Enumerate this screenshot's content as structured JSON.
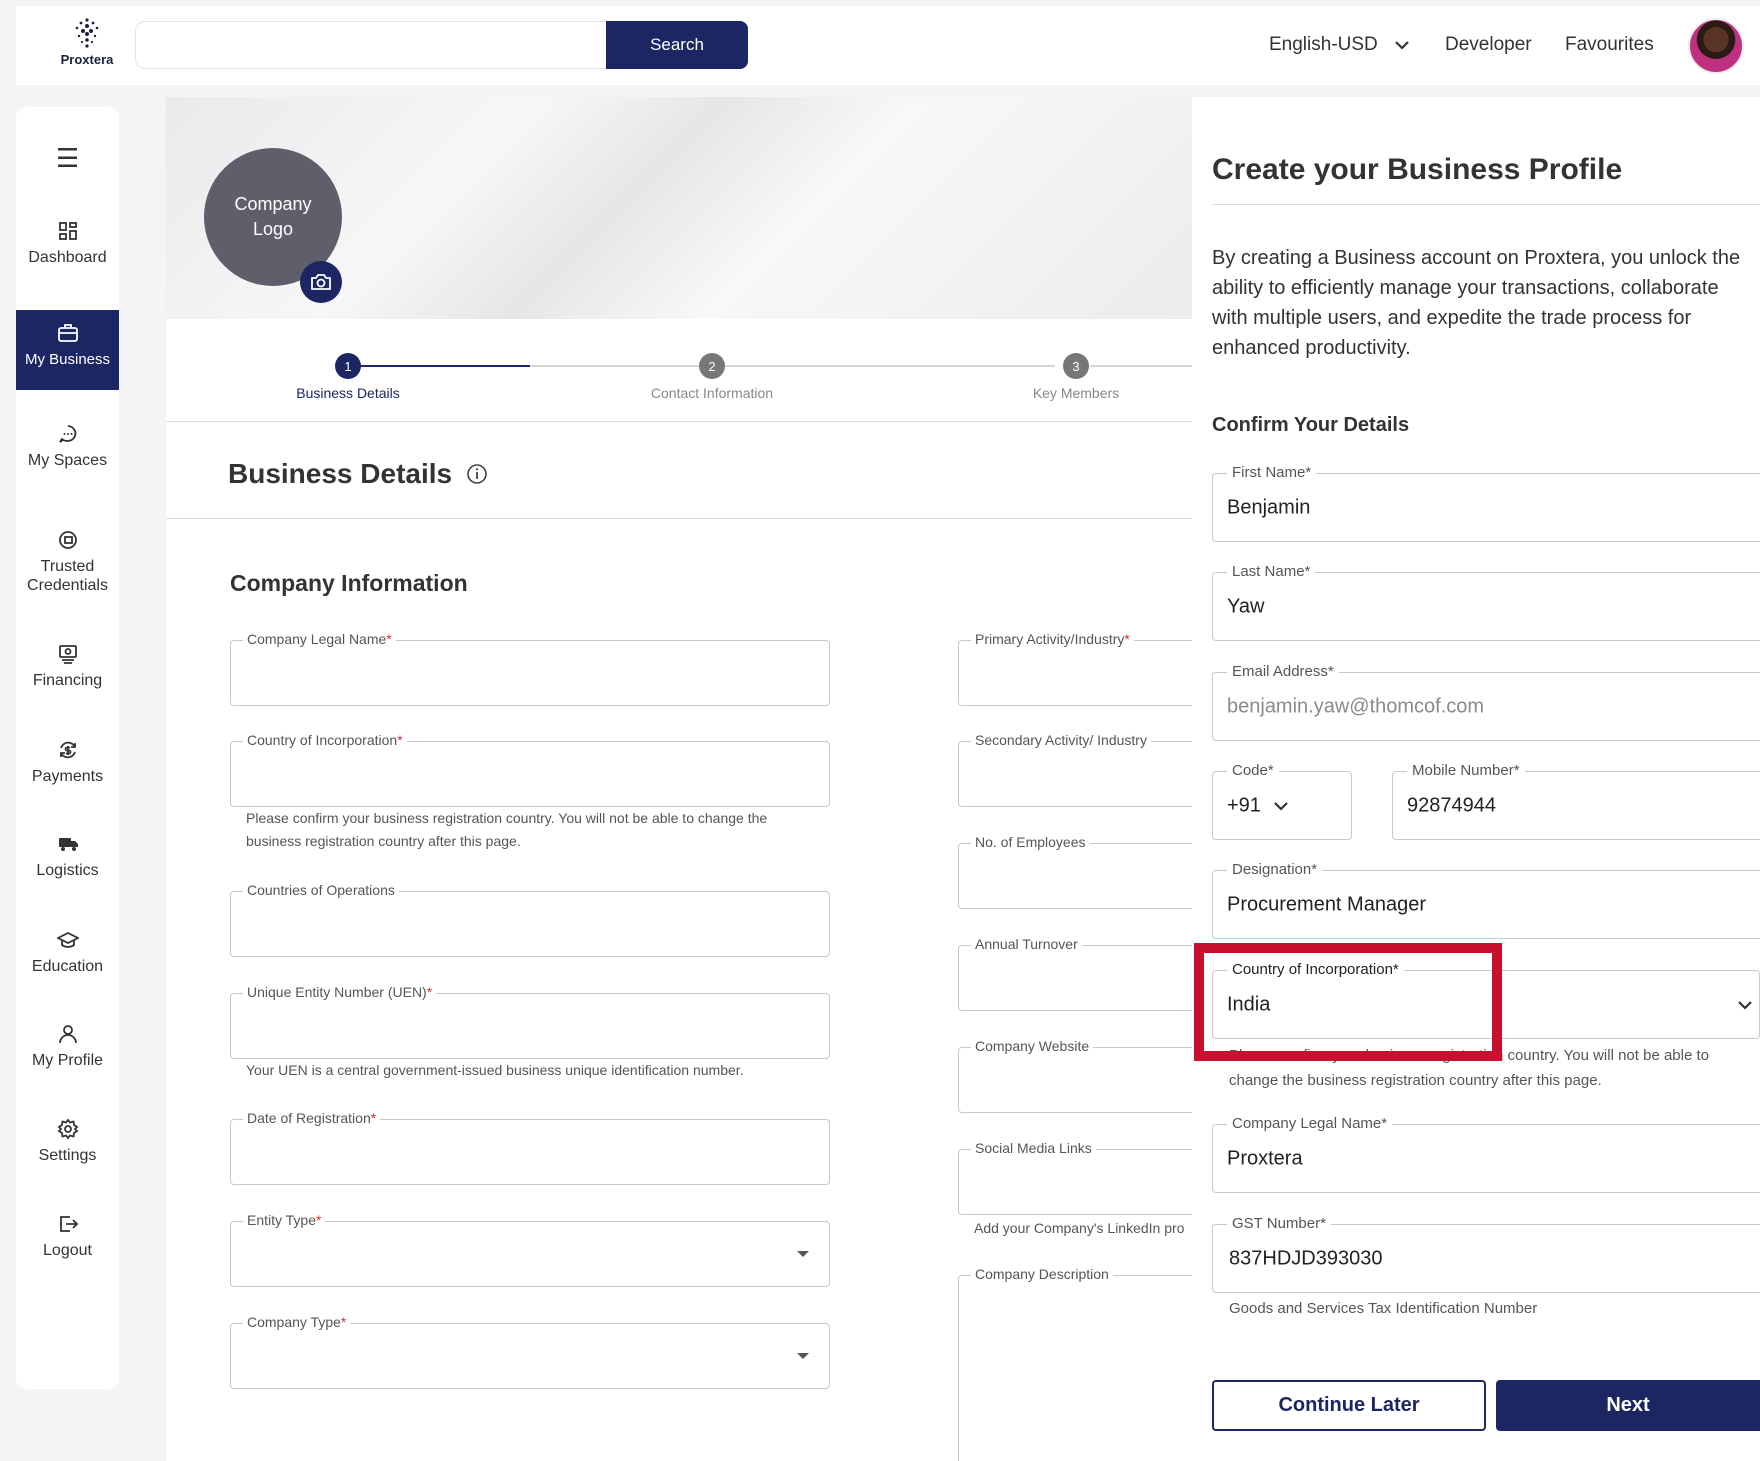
{
  "brand": {
    "name": "Proxtera"
  },
  "topbar": {
    "search_button": "Search",
    "language": "English-USD",
    "developer": "Developer",
    "favourites": "Favourites"
  },
  "sidebar": {
    "items": [
      {
        "label": "Dashboard",
        "icon": "dashboard-icon"
      },
      {
        "label": "My Business",
        "icon": "briefcase-icon",
        "active": true
      },
      {
        "label": "My Spaces",
        "icon": "chat-icon"
      },
      {
        "label": "Trusted Credentials",
        "icon": "credentials-icon"
      },
      {
        "label": "Financing",
        "icon": "financing-icon"
      },
      {
        "label": "Payments",
        "icon": "payments-icon"
      },
      {
        "label": "Logistics",
        "icon": "truck-icon"
      },
      {
        "label": "Education",
        "icon": "graduation-cap-icon"
      },
      {
        "label": "My Profile",
        "icon": "user-icon"
      },
      {
        "label": "Settings",
        "icon": "gear-icon"
      },
      {
        "label": "Logout",
        "icon": "logout-icon"
      }
    ]
  },
  "hero": {
    "logo_placeholder": "Company Logo"
  },
  "steps": [
    {
      "num": "1",
      "label": "Business Details",
      "active": true
    },
    {
      "num": "2",
      "label": "Contact Information"
    },
    {
      "num": "3",
      "label": "Key Members"
    }
  ],
  "business": {
    "title": "Business Details",
    "section": "Company Information",
    "left_fields": {
      "legal_name": "Company Legal Name",
      "country": "Country of Incorporation",
      "country_help": "Please confirm your business registration country. You will not be able to change the business registration country after this page.",
      "countries_ops": "Countries of Operations",
      "uen": "Unique Entity Number (UEN)",
      "uen_help": "Your UEN is a central government-issued business unique identification number.",
      "date_reg": "Date of Registration",
      "entity_type": "Entity Type",
      "company_type": "Company Type"
    },
    "right_fields": {
      "primary": "Primary Activity/Industry",
      "secondary": "Secondary Activity/ Industry",
      "employees": "No. of Employees",
      "turnover": "Annual Turnover",
      "website": "Company Website",
      "social": "Social Media Links",
      "social_help": "Add your Company's LinkedIn pro",
      "description": "Company Description"
    }
  },
  "panel": {
    "title": "Create your Business Profile",
    "description": "By creating a Business account on Proxtera, you unlock the ability to efficiently manage your transactions, collaborate with multiple users, and expedite the trade process for enhanced productivity.",
    "confirm_title": "Confirm Your Details",
    "first_name": {
      "label": "First Name*",
      "value": "Benjamin"
    },
    "last_name": {
      "label": "Last Name*",
      "value": "Yaw"
    },
    "email": {
      "label": "Email Address*",
      "value": "benjamin.yaw@thomcof.com"
    },
    "code": {
      "label": "Code*",
      "value": "+91"
    },
    "mobile": {
      "label": "Mobile Number*",
      "value": "92874944"
    },
    "designation": {
      "label": "Designation*",
      "value": "Procurement Manager"
    },
    "country": {
      "label": "Country of Incorporation*",
      "value": "India"
    },
    "country_help": "Please confirm your business registration country. You will not be able to change the business registration country after this page.",
    "legal_name": {
      "label": "Company Legal Name*",
      "value": "Proxtera"
    },
    "gst": {
      "label": "GST Number*",
      "value": "837HDJD393030"
    },
    "gst_help": "Goods and Services Tax Identification Number",
    "continue_later": "Continue Later",
    "next": "Next"
  },
  "colors": {
    "primary": "#1b2663",
    "highlight": "#c8102e",
    "required": "#d32f2f"
  }
}
